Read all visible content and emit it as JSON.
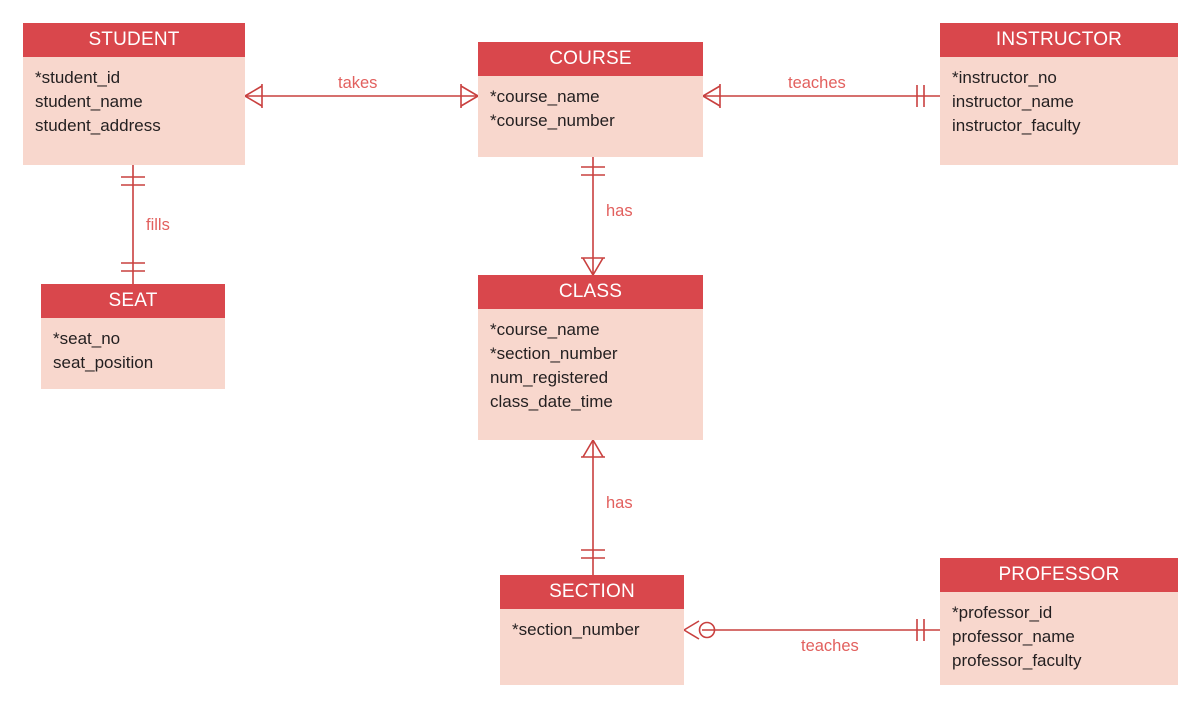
{
  "diagram": {
    "type": "entity-relationship-diagram",
    "notation": "crow's-foot",
    "colors": {
      "header_fill": "#d9474c",
      "body_fill": "#f8d7cd",
      "line": "#c9403f",
      "label_text": "#e2605e",
      "attr_text": "#231f20",
      "header_text": "#ffffff",
      "background": "#ffffff"
    }
  },
  "entities": {
    "student": {
      "title": "STUDENT",
      "attributes": [
        "*student_id",
        "student_name",
        "student_address"
      ]
    },
    "course": {
      "title": "COURSE",
      "attributes": [
        "*course_name",
        "*course_number"
      ]
    },
    "instructor": {
      "title": "INSTRUCTOR",
      "attributes": [
        "*instructor_no",
        "instructor_name",
        "instructor_faculty"
      ]
    },
    "seat": {
      "title": "SEAT",
      "attributes": [
        "*seat_no",
        "seat_position"
      ]
    },
    "class": {
      "title": "CLASS",
      "attributes": [
        "*course_name",
        "*section_number",
        "num_registered",
        "class_date_time"
      ]
    },
    "section": {
      "title": "SECTION",
      "attributes": [
        "*section_number"
      ]
    },
    "professor": {
      "title": "PROFESSOR",
      "attributes": [
        "*professor_id",
        "professor_name",
        "professor_faculty"
      ]
    }
  },
  "relationships": {
    "student_course": {
      "label": "takes",
      "from": "STUDENT",
      "to": "COURSE",
      "from_cardinality": "one-or-many",
      "to_cardinality": "one-or-many"
    },
    "course_instructor": {
      "label": "teaches",
      "from": "COURSE",
      "to": "INSTRUCTOR",
      "from_cardinality": "one-or-many",
      "to_cardinality": "one-and-only-one"
    },
    "student_seat": {
      "label": "fills",
      "from": "STUDENT",
      "to": "SEAT",
      "from_cardinality": "one-and-only-one",
      "to_cardinality": "one-and-only-one"
    },
    "course_class": {
      "label": "has",
      "from": "COURSE",
      "to": "CLASS",
      "from_cardinality": "one-and-only-one",
      "to_cardinality": "one-or-many"
    },
    "class_section": {
      "label": "has",
      "from": "CLASS",
      "to": "SECTION",
      "from_cardinality": "one-or-many",
      "to_cardinality": "one-and-only-one"
    },
    "section_professor": {
      "label": "teaches",
      "from": "SECTION",
      "to": "PROFESSOR",
      "from_cardinality": "zero-or-many",
      "to_cardinality": "one-and-only-one"
    }
  }
}
